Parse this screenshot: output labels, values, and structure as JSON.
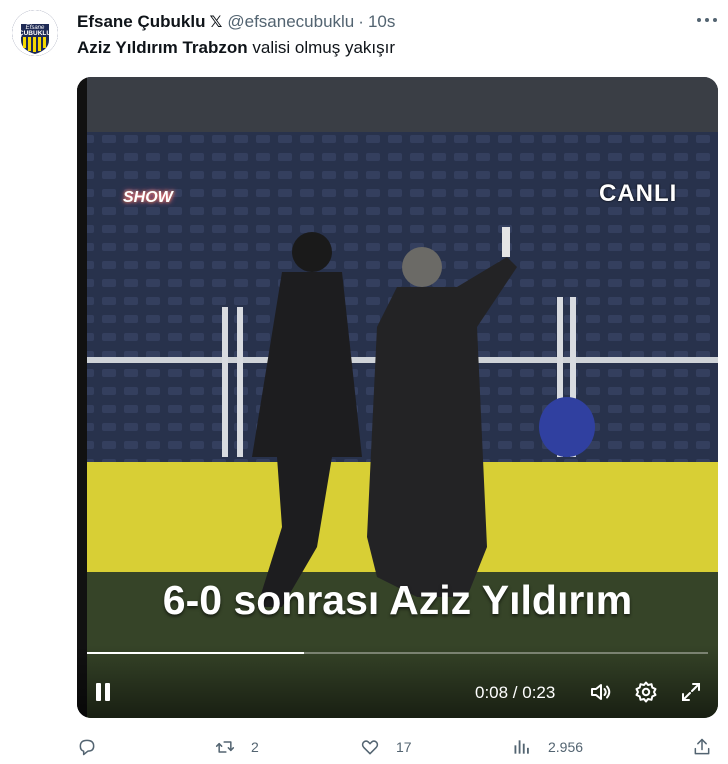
{
  "author": {
    "display_name": "Efsane Çubuklu",
    "verified_badge": "𝕏",
    "handle": "@efsanecubuklu",
    "separator": "·",
    "time": "10s",
    "avatar_text": "Efsane",
    "avatar_text2": "ÇUBUKLU"
  },
  "tweet": {
    "text_bold": "Aziz Yıldırım Trabzon",
    "text_rest": " valisi olmuş yakışır"
  },
  "video": {
    "overlay_live": "CANLI",
    "overlay_channel": "SHOW",
    "caption": "6-0 sonrası Aziz Yıldırım",
    "timecode": "0:08 / 0:23",
    "progress": 0.35,
    "icons": [
      "pause-icon",
      "volume-icon",
      "settings-icon",
      "fullscreen-icon"
    ]
  },
  "actions": {
    "reply_count": "",
    "retweet_count": "2",
    "like_count": "17",
    "views_count": "2.956",
    "share_count": ""
  },
  "colors": {
    "text_primary": "#0f1419",
    "text_secondary": "#536471",
    "avatar_bg": "#1e2a55",
    "avatar_accent": "#f5d800"
  }
}
